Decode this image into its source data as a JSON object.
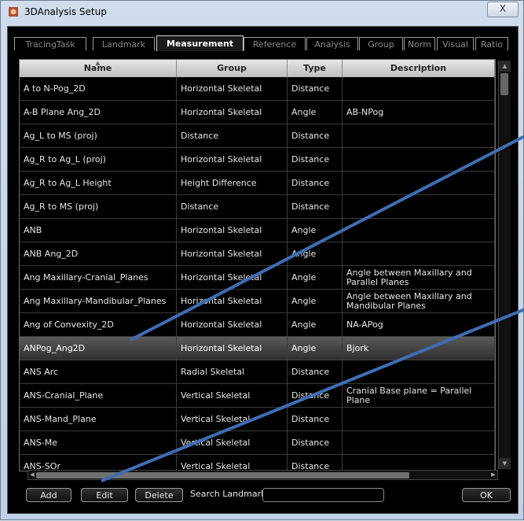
{
  "window": {
    "title": "3DAnalysis Setup",
    "close_glyph": "X"
  },
  "tabs": [
    {
      "label": "TracingTask",
      "active": false
    },
    {
      "label": "Landmark",
      "active": false
    },
    {
      "label": "Measurement",
      "active": true
    },
    {
      "label": "Reference",
      "active": false
    },
    {
      "label": "Analysis",
      "active": false
    },
    {
      "label": "Group",
      "active": false
    },
    {
      "label": "Norm",
      "active": false
    },
    {
      "label": "Visual",
      "active": false
    },
    {
      "label": "Ratio",
      "active": false
    }
  ],
  "grid": {
    "columns": [
      "Name",
      "Group",
      "Type",
      "Description"
    ],
    "sorted_column": "Name",
    "rows": [
      [
        "A to N-Pog_2D",
        "Horizontal Skeletal",
        "Distance",
        ""
      ],
      [
        "A-B Plane Ang_2D",
        "Horizontal Skeletal",
        "Angle",
        "AB-NPog"
      ],
      [
        "Ag_L to MS (proj)",
        "Distance",
        "Distance",
        ""
      ],
      [
        "Ag_R to Ag_L (proj)",
        "Horizontal Skeletal",
        "Distance",
        ""
      ],
      [
        "Ag_R to Ag_L Height",
        "Height Difference",
        "Distance",
        ""
      ],
      [
        "Ag_R to MS (proj)",
        "Distance",
        "Distance",
        ""
      ],
      [
        "ANB",
        "Horizontal Skeletal",
        "Angle",
        ""
      ],
      [
        "ANB Ang_2D",
        "Horizontal Skeletal",
        "Angle",
        ""
      ],
      [
        "Ang Maxillary-Cranial_Planes",
        "Horizontal Skeletal",
        "Angle",
        "Angle between Maxillary and Parallel Planes"
      ],
      [
        "Ang Maxillary-Mandibular_Planes",
        "Horizontal Skeletal",
        "Angle",
        "Angle between Maxillary and Mandibular Planes"
      ],
      [
        "Ang of Convexity_2D",
        "Horizontal Skeletal",
        "Angle",
        "NA-APog"
      ],
      [
        "ANPog_Ang2D",
        "Horizontal Skeletal",
        "Angle",
        "Bjork"
      ],
      [
        "ANS Arc",
        "Radial Skeletal",
        "Distance",
        ""
      ],
      [
        "ANS-Cranial_Plane",
        "Vertical Skeletal",
        "Distance",
        "Cranial Base plane = Parallel Plane"
      ],
      [
        "ANS-Mand_Plane",
        "Vertical Skeletal",
        "Distance",
        ""
      ],
      [
        "ANS-Me",
        "Vertical Skeletal",
        "Distance",
        ""
      ],
      [
        "ANS-SOr",
        "Vertical Skeletal",
        "Distance",
        ""
      ]
    ],
    "selected_row": 11
  },
  "buttons": {
    "add": "Add",
    "edit": "Edit",
    "delete": "Delete",
    "ok": "OK"
  },
  "search": {
    "label": "Search Landmark:",
    "value": ""
  },
  "colors": {
    "annotation_line": "#3f6db3",
    "selection": "#4a4a4a",
    "grid_bg": "#000000"
  }
}
